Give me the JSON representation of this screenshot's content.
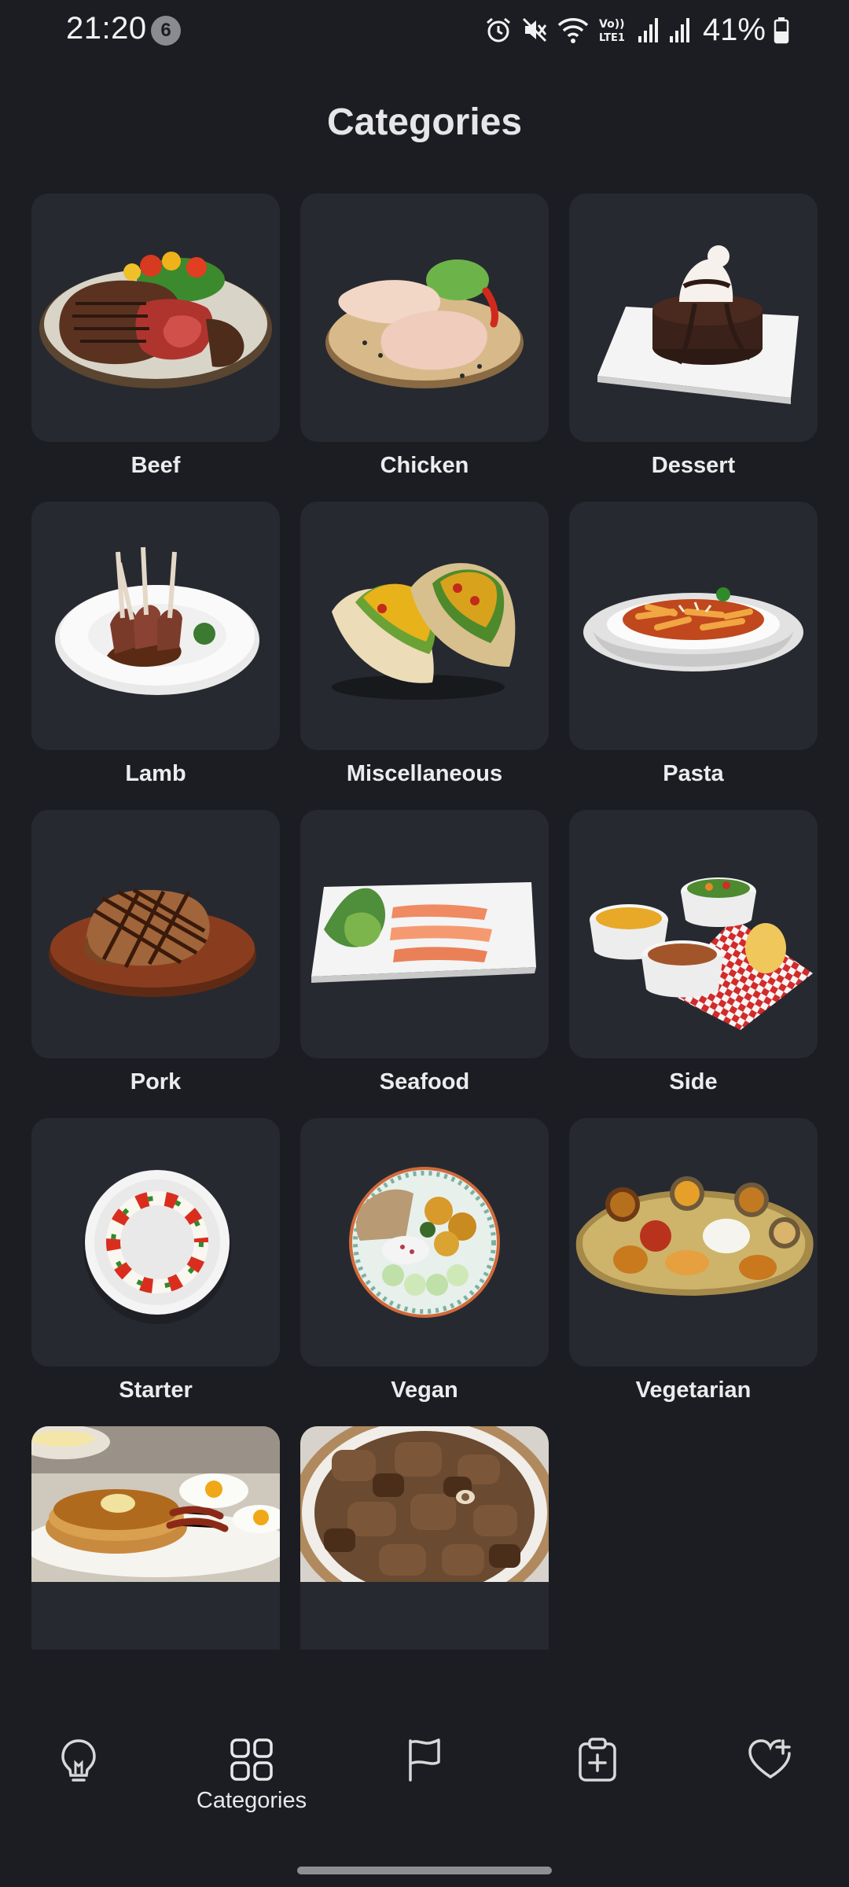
{
  "status_bar": {
    "time": "21:20",
    "notification_count": "6",
    "battery": "41%"
  },
  "page": {
    "title": "Categories"
  },
  "categories": [
    {
      "label": "Beef",
      "icon": "steak-plate-image"
    },
    {
      "label": "Chicken",
      "icon": "raw-chicken-image"
    },
    {
      "label": "Dessert",
      "icon": "chocolate-cake-image"
    },
    {
      "label": "Lamb",
      "icon": "lamb-chops-image"
    },
    {
      "label": "Miscellaneous",
      "icon": "tacos-image"
    },
    {
      "label": "Pasta",
      "icon": "pasta-bowl-image"
    },
    {
      "label": "Pork",
      "icon": "pork-chop-image"
    },
    {
      "label": "Seafood",
      "icon": "salmon-plate-image"
    },
    {
      "label": "Side",
      "icon": "side-dishes-image"
    },
    {
      "label": "Starter",
      "icon": "caprese-image"
    },
    {
      "label": "Vegan",
      "icon": "vegan-bowl-image"
    },
    {
      "label": "Vegetarian",
      "icon": "thali-platter-image"
    },
    {
      "label": "",
      "icon": "pancakes-breakfast-image"
    },
    {
      "label": "",
      "icon": "goat-curry-image"
    }
  ],
  "bottom_nav": {
    "items": [
      {
        "label": "",
        "icon": "lightbulb-icon"
      },
      {
        "label": "Categories",
        "icon": "grid-icon",
        "active": true
      },
      {
        "label": "",
        "icon": "flag-icon"
      },
      {
        "label": "",
        "icon": "clipboard-plus-icon"
      },
      {
        "label": "",
        "icon": "heart-plus-icon"
      }
    ]
  },
  "colors": {
    "background": "#1c1d22",
    "card": "#272930",
    "text": "#ececee"
  }
}
